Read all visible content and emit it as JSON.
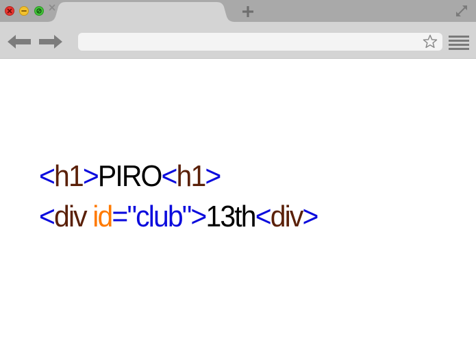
{
  "browser": {
    "omnibox": {
      "value": "",
      "placeholder": ""
    },
    "icons": {
      "close": "close-icon",
      "minimize": "minimize-icon",
      "maximize": "maximize-icon",
      "tab_close": "close-icon",
      "new_tab": "plus-icon",
      "fullscreen": "expand-icon",
      "back": "arrow-left-icon",
      "forward": "arrow-right-icon",
      "bookmark": "star-icon",
      "menu": "hamburger-icon"
    }
  },
  "page": {
    "line1": {
      "open_lt": "<",
      "open_tag": "h1",
      "open_gt": ">",
      "text": "PIRO",
      "close_lt": "<",
      "close_tag": "h1",
      "close_gt": ">"
    },
    "line2": {
      "open_lt": "<",
      "open_tag": "div",
      "attr_name": "id",
      "equals_quote": "=\"",
      "attr_value": "club",
      "quote_gt": "\">",
      "text": "13th",
      "close_lt": "<",
      "close_tag": "div",
      "close_gt": ">"
    }
  },
  "colors": {
    "punctuation": "#0b0bdd",
    "tag": "#5a2008",
    "attribute": "#ff7a00",
    "string": "#0b0bdd",
    "text": "#000000",
    "chrome_tabstrip": "#a9a9a9",
    "chrome_toolbar": "#d4d4d4"
  }
}
